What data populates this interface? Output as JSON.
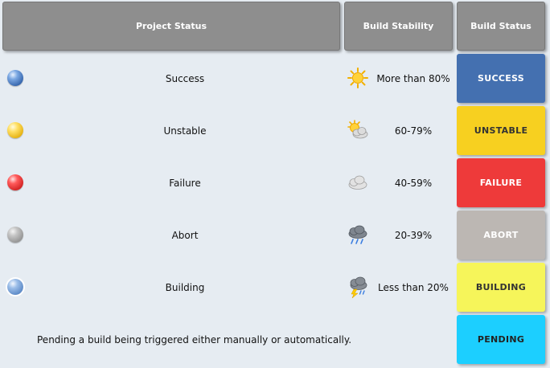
{
  "headers": {
    "project_status": "Project Status",
    "build_stability": "Build Stability",
    "build_status": "Build Status"
  },
  "rows": [
    {
      "status": "Success",
      "ball_color": "#4a7fc4",
      "weather_icon": "sunny-icon",
      "stability": "More than 80%",
      "badge": "SUCCESS",
      "badge_bg": "#4470b0",
      "badge_fg": "#ffffff"
    },
    {
      "status": "Unstable",
      "ball_color": "#f2c92a",
      "weather_icon": "partly-cloudy-icon",
      "stability": "60-79%",
      "badge": "UNSTABLE",
      "badge_bg": "#f7d020",
      "badge_fg": "#333333"
    },
    {
      "status": "Failure",
      "ball_color": "#e23030",
      "weather_icon": "cloudy-icon",
      "stability": "40-59%",
      "badge": "FAILURE",
      "badge_bg": "#ee3a3a",
      "badge_fg": "#ffffff"
    },
    {
      "status": "Abort",
      "ball_color": "#a9a9a9",
      "weather_icon": "rain-icon",
      "stability": "20-39%",
      "badge": "ABORT",
      "badge_bg": "#bcb7b3",
      "badge_fg": "#ffffff"
    },
    {
      "status": "Building",
      "ball_color": "#6f9bd6",
      "weather_icon": "thunderstorm-icon",
      "stability": "Less than 20%",
      "badge": "BUILDING",
      "badge_bg": "#f6f55a",
      "badge_fg": "#333333"
    }
  ],
  "pending": {
    "text": "Pending a build being triggered either manually or automatically.",
    "badge": "PENDING",
    "badge_bg": "#1ccfff",
    "badge_fg": "#222222"
  }
}
